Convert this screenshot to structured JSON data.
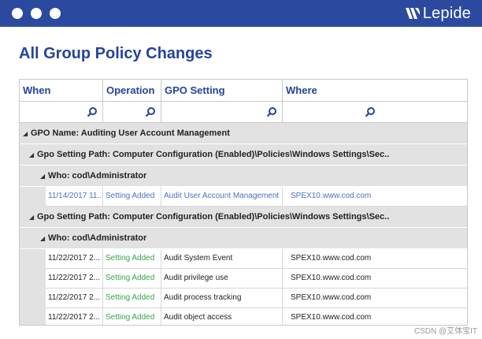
{
  "header": {
    "brand": "Lepide"
  },
  "page": {
    "title": "All Group Policy Changes"
  },
  "table": {
    "columns": [
      "When",
      "Operation",
      "GPO Setting",
      "Where"
    ],
    "gpo_name": "GPO Name: Auditing User Account Management",
    "groups": [
      {
        "path": "Gpo Setting Path: Computer Configuration (Enabled)\\Policies\\Windows Settings\\Sec..",
        "who": "Who: cod\\Administrator",
        "rows": [
          {
            "when": "11/14/2017 11...",
            "operation": "Setting Added",
            "setting": "Audit User Account Management",
            "where": "SPEX10.www.cod.com"
          }
        ]
      },
      {
        "path": "Gpo Setting Path: Computer Configuration (Enabled)\\Policies\\Windows Settings\\Sec..",
        "who": "Who: cod\\Administrator",
        "rows": [
          {
            "when": "11/22/2017 2...",
            "operation": "Setting Added",
            "setting": "Audit System Event",
            "where": "SPEX10.www.cod.com"
          },
          {
            "when": "11/22/2017 2...",
            "operation": "Setting Added",
            "setting": "Audit privilege use",
            "where": "SPEX10.www.cod.com"
          },
          {
            "when": "11/22/2017 2...",
            "operation": "Setting Added",
            "setting": "Audit process tracking",
            "where": "SPEX10.www.cod.com"
          },
          {
            "when": "11/22/2017 2...",
            "operation": "Setting Added",
            "setting": "Audit object access",
            "where": "SPEX10.www.cod.com"
          }
        ]
      }
    ]
  },
  "watermark": "CSDN @艾体宝IT",
  "colors": {
    "brand_blue": "#2b4a9f",
    "title_blue": "#25449a",
    "link_blue": "#4a73c4",
    "added_green": "#3aa34b"
  }
}
